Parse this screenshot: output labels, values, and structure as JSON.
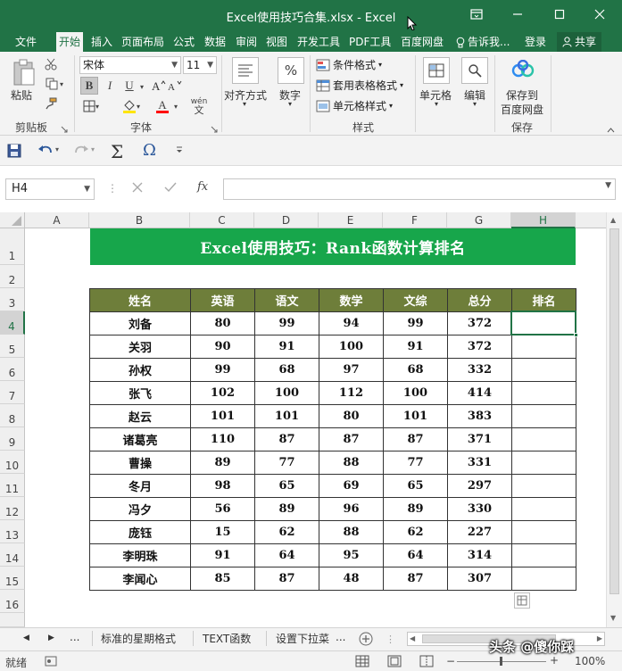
{
  "window": {
    "title": "Excel使用技巧合集.xlsx - Excel"
  },
  "tabs": [
    {
      "label": "文件"
    },
    {
      "label": "开始"
    },
    {
      "label": "插入"
    },
    {
      "label": "页面布局"
    },
    {
      "label": "公式"
    },
    {
      "label": "数据"
    },
    {
      "label": "审阅"
    },
    {
      "label": "视图"
    },
    {
      "label": "开发工具"
    },
    {
      "label": "PDF工具"
    },
    {
      "label": "百度网盘"
    }
  ],
  "tell_me": "告诉我...",
  "login": "登录",
  "share": "共享",
  "ribbon": {
    "paste": "粘贴",
    "clipboard_group": "剪贴板",
    "font_name": "宋体",
    "font_size": "11",
    "font_group": "字体",
    "bold": "B",
    "italic": "I",
    "underline": "U",
    "font_color_letter": "A",
    "wen": "wén",
    "align": "对齐方式",
    "number": "数字",
    "percent": "%",
    "conditional_format": "条件格式",
    "table_format": "套用表格格式",
    "cell_style": "单元格样式",
    "styles_group": "样式",
    "cells": "单元格",
    "edit": "编辑",
    "save_baidu_line1": "保存到",
    "save_baidu_line2": "百度网盘",
    "save_group": "保存"
  },
  "formula_bar": {
    "name_box": "H4",
    "fx": "fx",
    "value": ""
  },
  "sheet": {
    "columns": [
      "A",
      "B",
      "C",
      "D",
      "E",
      "F",
      "G",
      "H"
    ],
    "selected_column": "H",
    "rows": [
      "1",
      "2",
      "3",
      "4",
      "5",
      "6",
      "7",
      "8",
      "9",
      "10",
      "11",
      "12",
      "13",
      "14",
      "15",
      "16"
    ],
    "selected_row": "4",
    "selected_cell": "H4",
    "banner_title": "Excel使用技巧：Rank函数计算排名",
    "table": {
      "headers": [
        "姓名",
        "英语",
        "语文",
        "数学",
        "文综",
        "总分",
        "排名"
      ],
      "rows": [
        [
          "刘备",
          "80",
          "99",
          "94",
          "99",
          "372",
          ""
        ],
        [
          "关羽",
          "90",
          "91",
          "100",
          "91",
          "372",
          ""
        ],
        [
          "孙权",
          "99",
          "68",
          "97",
          "68",
          "332",
          ""
        ],
        [
          "张飞",
          "102",
          "100",
          "112",
          "100",
          "414",
          ""
        ],
        [
          "赵云",
          "101",
          "101",
          "80",
          "101",
          "383",
          ""
        ],
        [
          "诸葛亮",
          "110",
          "87",
          "87",
          "87",
          "371",
          ""
        ],
        [
          "曹操",
          "89",
          "77",
          "88",
          "77",
          "331",
          ""
        ],
        [
          "冬月",
          "98",
          "65",
          "69",
          "65",
          "297",
          ""
        ],
        [
          "冯夕",
          "56",
          "89",
          "96",
          "89",
          "330",
          ""
        ],
        [
          "庞钰",
          "15",
          "62",
          "88",
          "62",
          "227",
          ""
        ],
        [
          "李明珠",
          "91",
          "64",
          "95",
          "64",
          "314",
          ""
        ],
        [
          "李闻心",
          "85",
          "87",
          "48",
          "87",
          "307",
          ""
        ]
      ]
    }
  },
  "sheet_tabs": {
    "ellipsis_left": "...",
    "tabs": [
      "标准的星期格式",
      "TEXT函数",
      "设置下拉菜"
    ],
    "ellipsis_right": "..."
  },
  "status": {
    "ready": "就绪",
    "zoom": "100%",
    "watermark": "头条 @傻你踩"
  }
}
